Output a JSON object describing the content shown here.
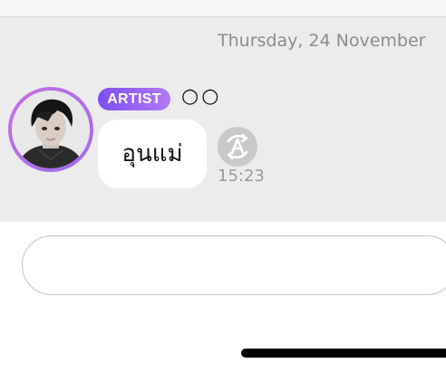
{
  "chat": {
    "date_separator": "Thursday, 24 November",
    "message": {
      "badge": "ARTIST",
      "sender": "○○",
      "text": "อุนแม่",
      "time": "15:23",
      "translate_icon": "translate-icon",
      "avatar_ring_colors": [
        "#c96ee6",
        "#9b6cf0"
      ],
      "badge_colors": [
        "#7d4df2",
        "#b27af5"
      ]
    }
  },
  "composer": {
    "input_value": "",
    "input_placeholder": ""
  }
}
